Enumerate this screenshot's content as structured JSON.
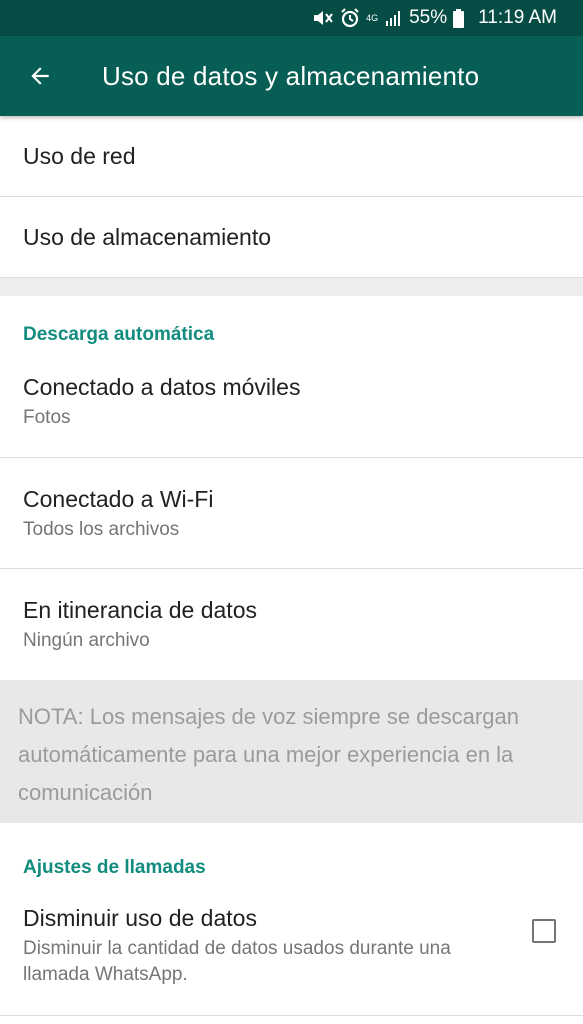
{
  "status_bar": {
    "network": "4G",
    "battery": "55%",
    "time": "11:19 AM",
    "icons": [
      "mute-icon",
      "alarm-icon",
      "signal-icon",
      "battery-icon"
    ]
  },
  "app_bar": {
    "title": "Uso de datos y almacenamiento",
    "back_icon": "arrow-left-icon"
  },
  "items": {
    "network_usage": "Uso de red",
    "storage_usage": "Uso de almacenamiento"
  },
  "auto_download": {
    "header": "Descarga automática",
    "mobile_data": {
      "title": "Conectado a datos móviles",
      "value": "Fotos"
    },
    "wifi": {
      "title": "Conectado a Wi-Fi",
      "value": "Todos los archivos"
    },
    "roaming": {
      "title": "En itinerancia de datos",
      "value": "Ningún archivo"
    },
    "note": "NOTA: Los mensajes de voz siempre se descargan automáticamente para una mejor experiencia en la comunicación"
  },
  "call_settings": {
    "header": "Ajustes de llamadas",
    "low_data": {
      "title": "Disminuir uso de datos",
      "description": "Disminuir la cantidad de datos usados durante una llamada WhatsApp.",
      "checked": false
    }
  },
  "colors": {
    "status_bar": "#054d44",
    "app_bar": "#075e54",
    "accent": "#128c7e",
    "note_bg": "#e8e8e8"
  }
}
